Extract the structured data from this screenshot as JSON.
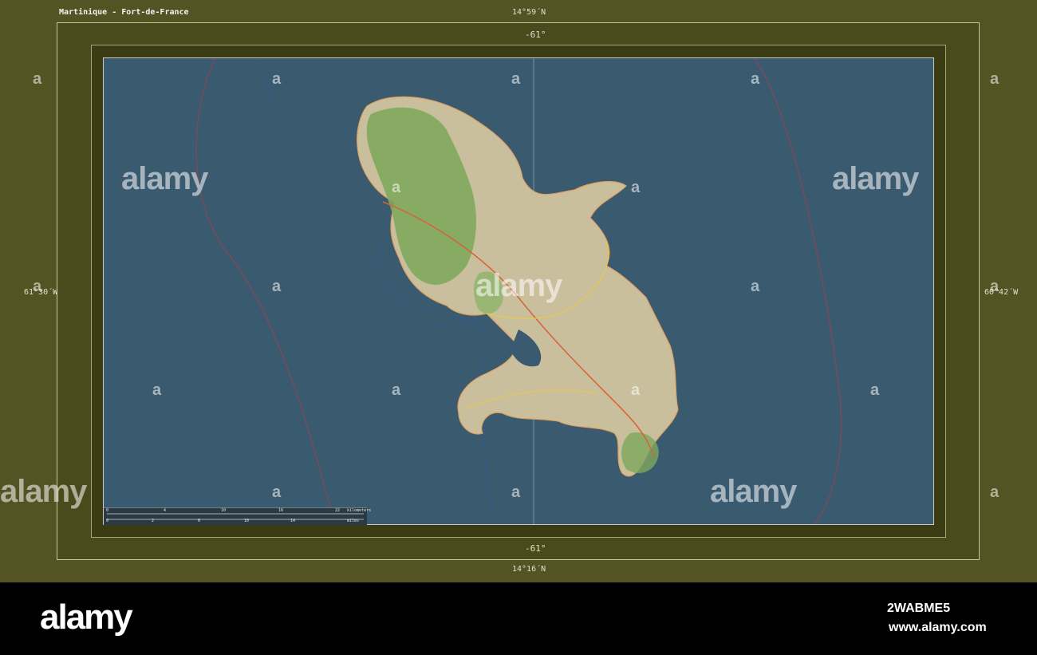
{
  "map": {
    "title": "Martinique - Fort-de-France",
    "lat_top": "14°59´N",
    "lat_bottom": "14°16´N",
    "lon_left": "61°30´W",
    "lon_right": "60°42´W",
    "meridian_top": "-61°",
    "meridian_bottom": "-61°",
    "scale": {
      "kilometers_label": "kilometers",
      "miles_label": "miles",
      "km_ticks": [
        "0",
        "4",
        "10",
        "16",
        "22"
      ],
      "mi_ticks": [
        "0",
        "2",
        "6",
        "10",
        "14"
      ]
    },
    "colors": {
      "sea": "#3a5a6f",
      "land": "#c9bf9d",
      "forest": "#7fa85c",
      "frame": "#535323"
    }
  },
  "watermark": {
    "text": "alamy",
    "small": "a"
  },
  "footer": {
    "brand": "alamy",
    "image_id": "2WABME5",
    "url": "www.alamy.com"
  }
}
